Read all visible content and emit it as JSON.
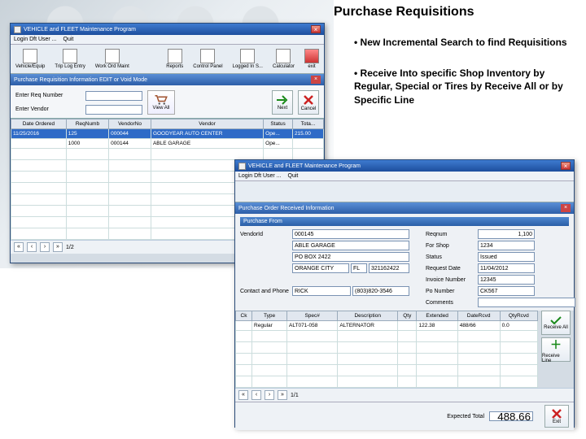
{
  "heading": "Purchase Requisitions",
  "bullets": [
    "•  New Incremental Search to find Requisitions",
    "•  Receive Into specific Shop Inventory by Regular, Special or Tires by Receive All or by Specific Line"
  ],
  "win1": {
    "title": "VEHICLE and FLEET Maintenance Program",
    "menu": [
      "Login Dft User ...",
      "Quit"
    ],
    "ribbon": [
      "Vehicle/Equip",
      "Trip Log Entry",
      "Work Ord Maint",
      "Reports",
      "Control Panel",
      "Logged In S...",
      "Calculator",
      "exit"
    ],
    "subbar": "Purchase Requisition Information EDIT or Void Mode",
    "form": {
      "l1": "Enter Req Number",
      "l2": "Enter Vendor",
      "viewall": "View All",
      "next": "Next",
      "cancel": "Cancel"
    },
    "cols": [
      "Date Ordered",
      "ReqNumb",
      "VendorNo",
      "Vendor",
      "Status",
      "Tota..."
    ],
    "rows": [
      {
        "date": "11/25/2016",
        "req": "125",
        "vno": "000044",
        "vendor": "GOODYEAR AUTO CENTER",
        "status": "Ope...",
        "total": "215.00"
      },
      {
        "date": "",
        "req": "1000",
        "vno": "000144",
        "vendor": "ABLE GARAGE",
        "status": "Ope...",
        "total": ""
      }
    ],
    "pager": "1/2"
  },
  "win2": {
    "title": "VEHICLE and FLEET Maintenance Program",
    "menu": [
      "Login Dft User ...",
      "Quit"
    ],
    "subbar": "Purchase Order Received Information",
    "sec": "Purchase From",
    "left": {
      "vendorid_l": "VendorId",
      "vendorid": "000145",
      "v1": "ABLE GARAGE",
      "v2": "PO BOX 2422",
      "v3": "ORANGE CITY",
      "st": "FL",
      "zip": "321162422",
      "contact_l": "Contact and Phone",
      "contact": "RICK",
      "phone": "(803)820-3546"
    },
    "right": {
      "reqnum_l": "Reqnum",
      "reqnum": "1,100",
      "forshop_l": "For Shop",
      "forshop": "1234",
      "status_l": "Status",
      "status": "Issued",
      "reqdate_l": "Request Date",
      "reqdate": "11/04/2012",
      "invno_l": "Invoice Number",
      "invno": "12345",
      "pono_l": "Po Number",
      "pono": "CK567",
      "comments_l": "Comments"
    },
    "cols": [
      "Ck",
      "Type",
      "Spec#",
      "Description",
      "Qty",
      "Extended",
      "DateRcvd",
      "QtyRcvd"
    ],
    "row": {
      "ck": "",
      "type": "Regular",
      "spec": "ALT071-058",
      "desc": "ALTERNATOR",
      "qty": "",
      "ext": "122.38",
      "date": "488/66",
      "qrcvd": "0.0"
    },
    "buttons": {
      "recvall": "Receive All",
      "recvline": "Receive Line",
      "exit": "Exit"
    },
    "footer": {
      "label": "Expected Total",
      "value": "488.66"
    },
    "pager": "1/1"
  }
}
